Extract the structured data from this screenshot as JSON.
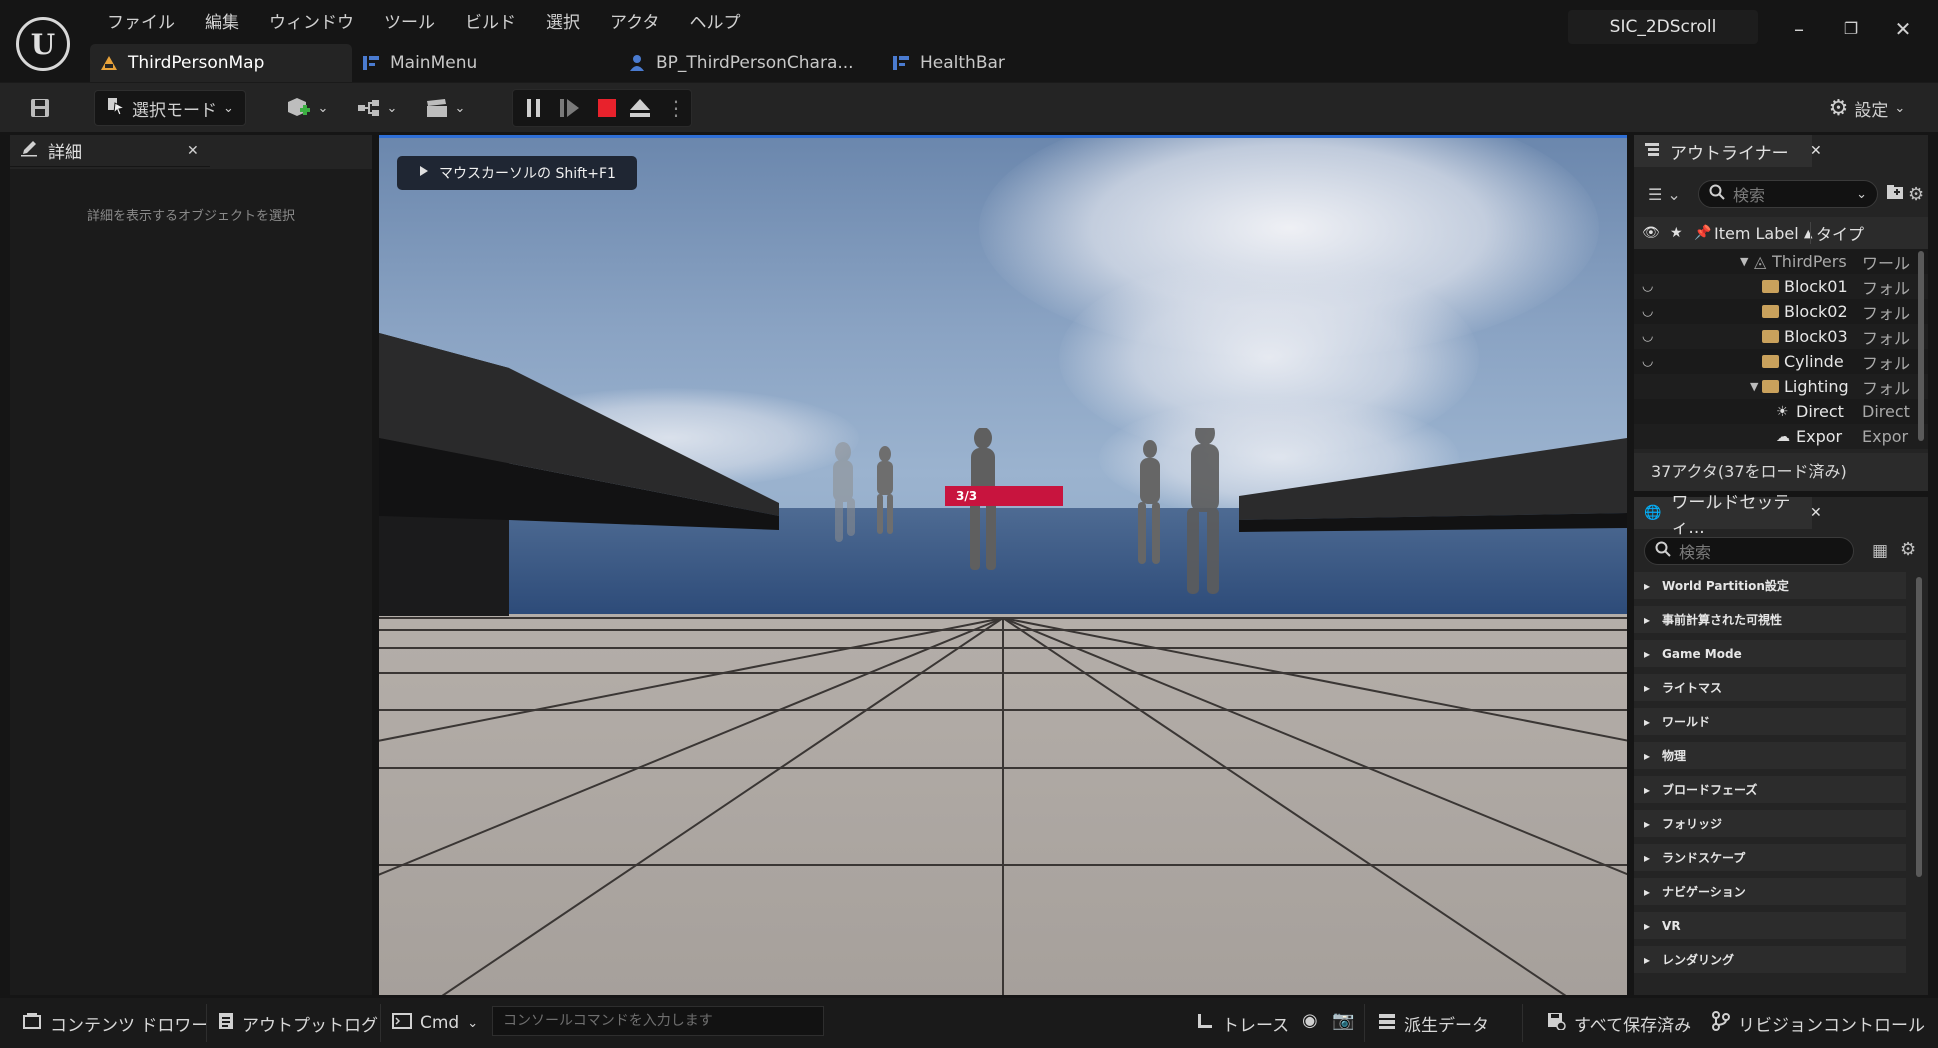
{
  "title_bar": {
    "menu": [
      "ファイル",
      "編集",
      "ウィンドウ",
      "ツール",
      "ビルド",
      "選択",
      "アクタ",
      "ヘルプ"
    ],
    "tabs": [
      {
        "label": "ThirdPersonMap",
        "icon": "level-icon"
      },
      {
        "label": "MainMenu",
        "icon": "widget-blueprint-icon"
      },
      {
        "label": "BP_ThirdPersonChara...",
        "icon": "character-blueprint-icon"
      },
      {
        "label": "HealthBar",
        "icon": "widget-blueprint-icon"
      }
    ],
    "project_name": "SIC_2DScroll",
    "window_controls": {
      "minimize": "–",
      "restore": "❐",
      "close": "✕"
    }
  },
  "toolbar": {
    "mode_label": "選択モード",
    "settings_label": "設定"
  },
  "details_panel": {
    "tab_label": "詳細",
    "empty_message": "詳細を表示するオブジェクトを選択"
  },
  "viewport": {
    "mouse_hint": "マウスカーソルの Shift+F1",
    "health_bar_text": "3/3",
    "health_fraction": 1.0,
    "health_color": "#c8143e"
  },
  "outliner": {
    "tab_label": "アウトライナー",
    "search_placeholder": "検索",
    "col_label": "Item Label",
    "col_type": "タイプ",
    "rows": [
      {
        "name": "ThirdPers",
        "type": "ワール",
        "kind": "world"
      },
      {
        "name": "Block01",
        "type": "フォル",
        "kind": "folder"
      },
      {
        "name": "Block02",
        "type": "フォル",
        "kind": "folder"
      },
      {
        "name": "Block03",
        "type": "フォル",
        "kind": "folder"
      },
      {
        "name": "Cylinde",
        "type": "フォル",
        "kind": "folder"
      },
      {
        "name": "Lighting",
        "type": "フォル",
        "kind": "folder-open"
      },
      {
        "name": "Direct",
        "type": "Direct",
        "kind": "light"
      },
      {
        "name": "Expor",
        "type": "Expor",
        "kind": "fog"
      }
    ],
    "actor_count": "37アクタ(37をロード済み)"
  },
  "world_settings": {
    "tab_label": "ワールドセッティ...",
    "search_placeholder": "検索",
    "categories": [
      "World Partition設定",
      "事前計算された可視性",
      "Game Mode",
      "ライトマス",
      "ワールド",
      "物理",
      "ブロードフェーズ",
      "フォリッジ",
      "ランドスケープ",
      "ナビゲーション",
      "VR",
      "レンダリング"
    ]
  },
  "bottom_bar": {
    "content_drawer": "コンテンツ ドロワー",
    "output_log": "アウトプットログ",
    "cmd": "Cmd",
    "console_placeholder": "コンソールコマンドを入力します",
    "trace": "トレース",
    "derived_data": "派生データ",
    "save_all": "すべて保存済み",
    "revision_control": "リビジョンコントロール"
  }
}
